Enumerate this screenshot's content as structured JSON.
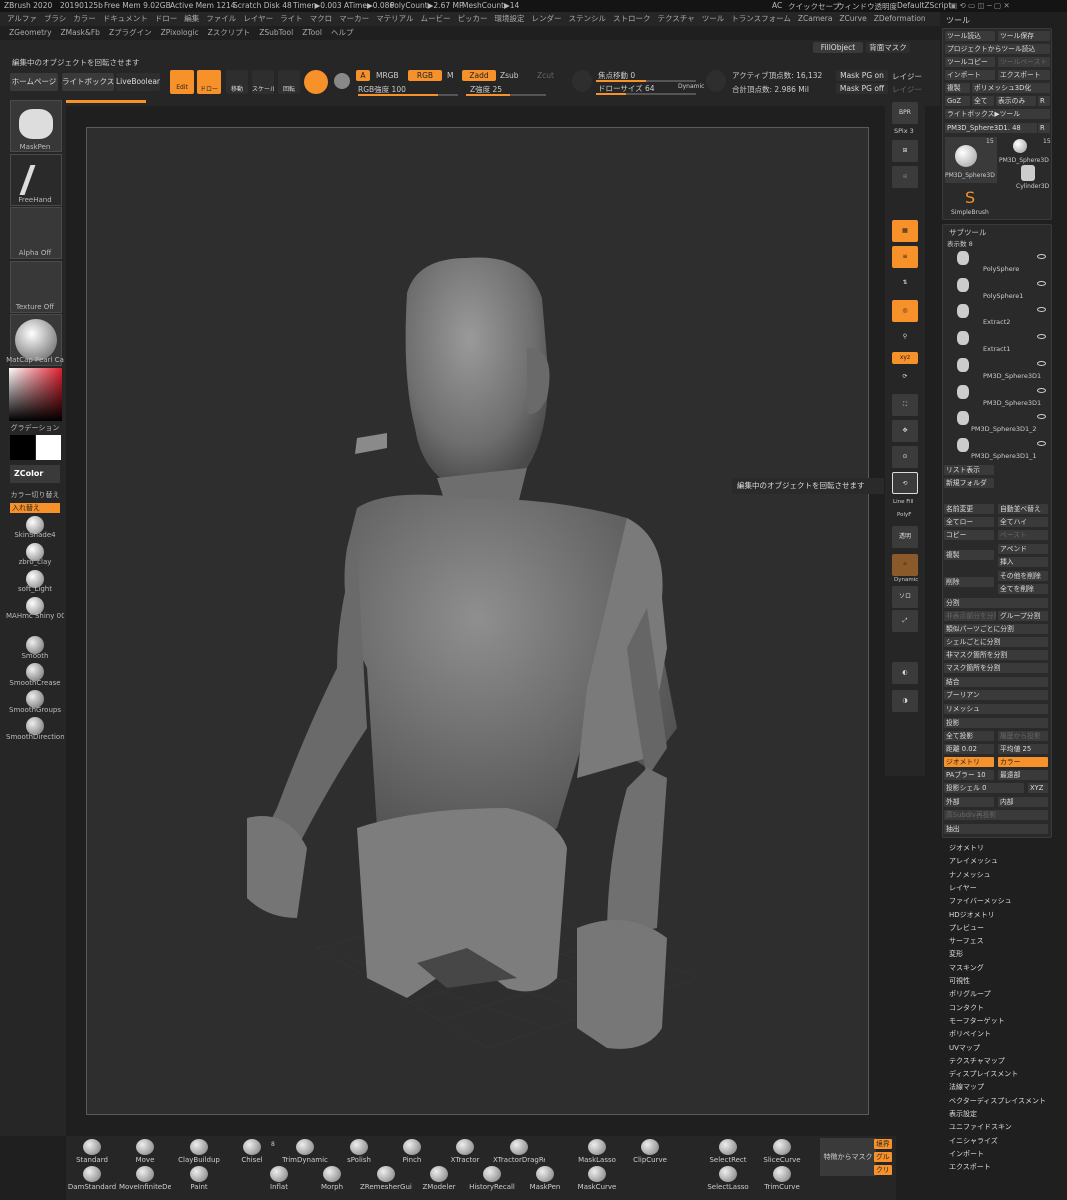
{
  "topbar": {
    "app": "ZBrush 2020",
    "build": "20190125b",
    "freemem": "Free Mem 9.02GB",
    "activemem": "Active Mem 1214",
    "scratch": "Scratch Disk 48",
    "timer": "Timer▶0.003 ATime▶0.086",
    "polycount": "PolyCount▶2.67 MP",
    "meshcount": "MeshCount▶14",
    "ac": "AC",
    "quicksave": "クイックセーブ",
    "transparency": "ウィンドウ透明度",
    "script": "DefaultZScript"
  },
  "menu1": [
    "アルファ",
    "ブラシ",
    "カラー",
    "ドキュメント",
    "ドロー",
    "編集",
    "ファイル",
    "レイヤー",
    "ライト",
    "マクロ",
    "マーカー",
    "マテリアル",
    "ムービー",
    "ピッカー",
    "環境設定",
    "レンダー",
    "ステンシル",
    "ストローク",
    "テクスチャ",
    "ツール",
    "トランスフォーム",
    "ZCamera",
    "ZCurve",
    "ZDeformation"
  ],
  "menu2": [
    "ZGeometry",
    "ZMask&Fb",
    "Zプラグイン",
    "ZPixologic",
    "Zスクリプト",
    "ZSubTool",
    "ZTool",
    "ヘルプ"
  ],
  "status": "編集中のオブジェクトを回転させます",
  "fillobject": "FillObject",
  "backmask": "背面マスク",
  "tabs": {
    "home": "ホームページ",
    "lightbox": "ライトボックス",
    "liveboolean": "LiveBoolean"
  },
  "draw": {
    "edit": "Edit",
    "draw": "ドロー",
    "move": "移動",
    "scale": "スケール",
    "rotate": "回転",
    "a": "A",
    "mrgb": "MRGB",
    "rgb": "RGB",
    "m": "M",
    "rgb_int": "RGB強度 100",
    "zadd": "Zadd",
    "zsub": "Zsub",
    "zcut": "Zcut",
    "z_int": "Z強度 25",
    "focal": "焦点移動 0",
    "drawsize": "ドローサイズ 64",
    "dynamic": "Dynamic",
    "active_pts": "アクティブ頂点数: 16,132",
    "total_pts": "合計頂点数: 2.986 Mil",
    "maskpg_on": "Mask PG on",
    "maskpg_off": "Mask PG off",
    "layer": "レイジー",
    "layer2": "レイジー"
  },
  "left": {
    "brush": "MaskPen",
    "stroke": "FreeHand",
    "alpha": "Alpha Off",
    "texture": "Texture Off",
    "material": "MatCap Pearl Ca",
    "gradient": "グラデーション",
    "zcolor": "ZColor",
    "colorswitch": "カラー切り替え",
    "swap": "入れ替え",
    "mats": [
      "SkinShade4",
      "zbro_clay",
      "soft_Light",
      "MAHmc Shiny 00"
    ],
    "smooth": [
      "Smooth",
      "SmoothCrease",
      "SmoothGroups",
      "SmoothDirection"
    ]
  },
  "right_icons": [
    "SPix 3",
    "Line Fill",
    "PolyF",
    "透明",
    "Dynamic",
    "ソロ"
  ],
  "tooltip": "編集中のオブジェクトを回転させます",
  "panel": {
    "title": "ツール",
    "load": "ツール読込",
    "save": "ツール保存",
    "projload": "プロジェクトからツール読込",
    "copy": "ツールコピー",
    "paste": "ツールペースト",
    "import": "インポート",
    "export": "エクスポート",
    "clone": "複製",
    "polymesh": "ポリメッシュ3D化",
    "goz": "GoZ",
    "all": "全て",
    "visible": "表示のみ",
    "r": "R",
    "lightbox_tool": "ライトボックス▶ツール",
    "current": "PM3D_Sphere3D1. 48",
    "thumbs": [
      "PM3D_Sphere3D",
      "PM3D_Sphere3D",
      "Cylinder3D",
      "SimpleBrush"
    ],
    "count": "15"
  },
  "subtool": {
    "title": "サブツール",
    "show": "表示数 8",
    "items": [
      "PolySphere",
      "PolySphere1",
      "Extract2",
      "Extract1",
      "PM3D_Sphere3D1",
      "PM3D_Sphere3D1",
      "PM3D_Sphere3D1_2",
      "PM3D_Sphere3D1_1"
    ],
    "list": "リスト表示",
    "newfolder": "新規フォルダ",
    "rename": "名前変更",
    "autosort": "自動並べ替え",
    "allow": "全てロー",
    "allhigh": "全てハイ",
    "copy": "コピー",
    "paste": "ペースト",
    "dup": "複製",
    "append": "アペンド",
    "insert": "挿入",
    "del": "削除",
    "delother": "その他を削除",
    "delall": "全てを削除",
    "split": "分割",
    "splithidden": "非表示部分を分割",
    "groupsplit": "グループ分割",
    "splitsimilar": "類似パーツごとに分割",
    "splitshell": "シェルごとに分割",
    "splitunmasked": "非マスク箇所を分割",
    "splitmasked": "マスク箇所を分割",
    "merge": "結合",
    "boolean": "ブーリアン",
    "remesh": "リメッシュ",
    "project": "投影",
    "projall": "全て投影",
    "projhist": "履歴から投影",
    "dist": "距離 0.02",
    "mean": "平均値 25",
    "geometry": "ジオメトリ",
    "color": "カラー",
    "pablur": "PAブラー 10",
    "farthest": "最遠部",
    "projshell": "投影シェル 0",
    "xyz": "XYZ",
    "outer": "外部",
    "inner": "内部",
    "subdiv": "高Subdiv再投影",
    "extract": "抽出"
  },
  "menu_list": [
    "ジオメトリ",
    "アレイメッシュ",
    "ナノメッシュ",
    "レイヤー",
    "ファイバーメッシュ",
    "HDジオメトリ",
    "プレビュー",
    "サーフェス",
    "変形",
    "マスキング",
    "可視性",
    "ポリグループ",
    "コンタクト",
    "モーフターゲット",
    "ポリペイント",
    "UVマップ",
    "テクスチャマップ",
    "ディスプレイスメント",
    "法線マップ",
    "ベクターディスプレイスメント",
    "表示設定",
    "ユニファイドスキン",
    "イニシャライズ",
    "インポート",
    "エクスポート"
  ],
  "brushes_top": [
    "Standard",
    "Move",
    "ClayBuildup",
    "Chisel",
    "TrimDynamic",
    "sPolish",
    "Pinch",
    "XTractor",
    "XTractorDragRec",
    "MaskLasso",
    "ClipCurve",
    "SelectRect",
    "SliceCurve"
  ],
  "brushes_bot": [
    "DamStandard",
    "MoveInfiniteDep",
    "Paint",
    "Inflat",
    "Morph",
    "ZRemesherGuide",
    "ZModeler",
    "HistoryRecall",
    "MaskPen",
    "MaskCurve",
    "SelectLasso",
    "TrimCurve"
  ],
  "chisel_n": "8",
  "zmodeler_n": "1",
  "feature_mask": "特徴からマスク",
  "side": [
    "境界",
    "グル",
    "クリ"
  ]
}
